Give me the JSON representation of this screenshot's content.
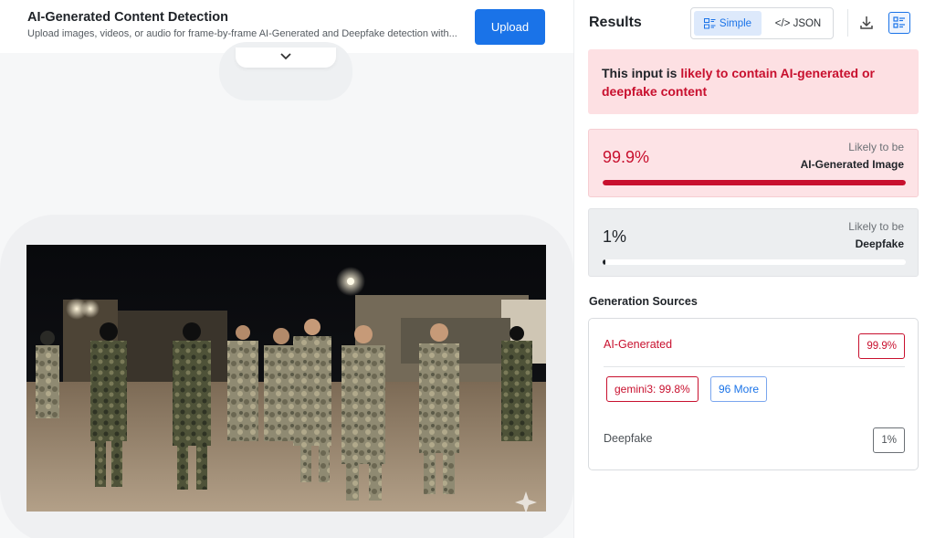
{
  "header": {
    "title": "AI-Generated Content Detection",
    "subtitle": "Upload images, videos, or audio for frame-by-frame AI-Generated and Deepfake detection with...",
    "upload_label": "Upload",
    "collapse_icon": "chevron-down-icon"
  },
  "media": {
    "watermark_icon": "sparkle-icon"
  },
  "results": {
    "title": "Results",
    "view_toggle": {
      "simple_label": "Simple",
      "simple_icon": "list-layout-icon",
      "json_label": "</> JSON",
      "selected": "Simple"
    },
    "download_icon": "download-icon",
    "list_view_icon": "list-view-icon",
    "verdict": {
      "prefix": "This input is ",
      "highlight": "likely to contain AI-generated or deepfake content"
    },
    "scores": [
      {
        "percent_label": "99.9%",
        "value": 0.999,
        "likely_label": "Likely to be",
        "category": "AI-Generated Image",
        "color": "#c8102e"
      },
      {
        "percent_label": "1%",
        "value": 0.01,
        "likely_label": "Likely to be",
        "category": "Deepfake",
        "color": "#1f2328"
      }
    ],
    "generation_sources": {
      "title": "Generation Sources",
      "ai": {
        "label": "AI-Generated",
        "badge": "99.9%"
      },
      "model_chip": "gemini3: 99.8%",
      "more_chip": "96 More",
      "deepfake": {
        "label": "Deepfake",
        "badge": "1%"
      }
    }
  },
  "colors": {
    "accent": "#1a73e8",
    "danger": "#c8102e",
    "danger_bg": "#fde0e3"
  }
}
